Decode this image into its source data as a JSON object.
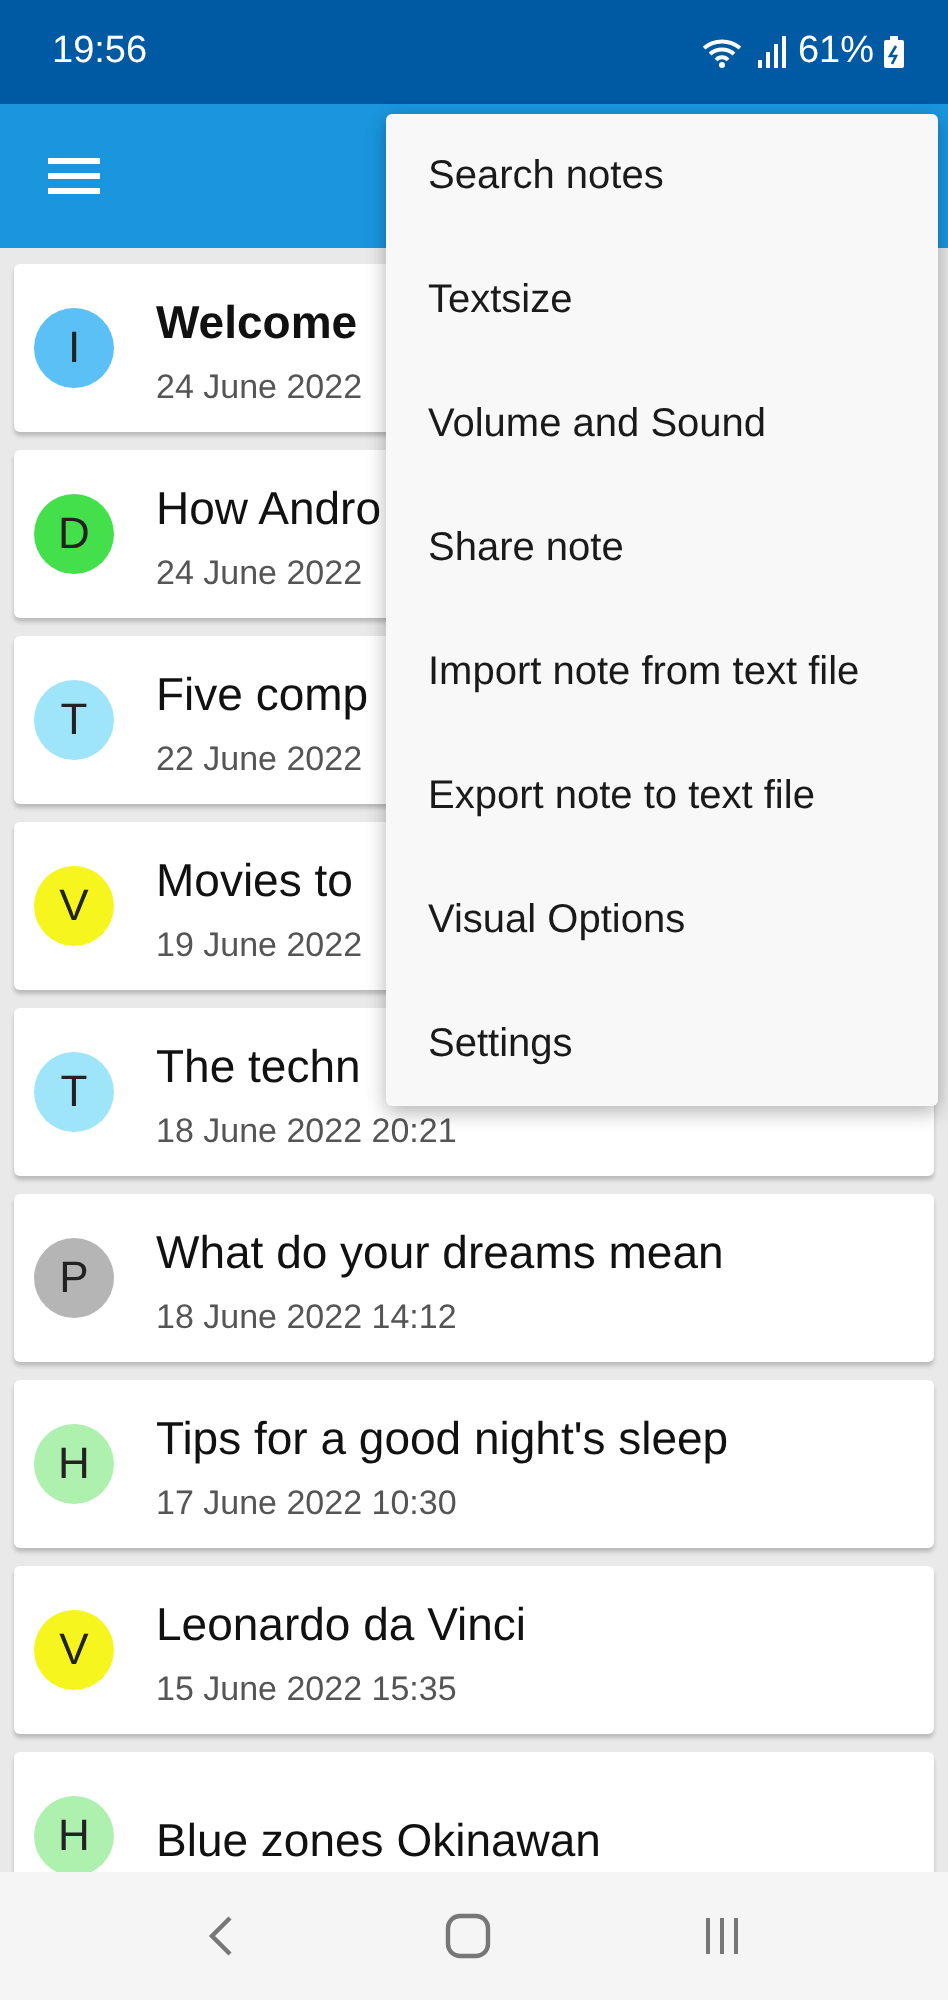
{
  "status_bar": {
    "time": "19:56",
    "battery": "61%"
  },
  "notes": [
    {
      "letter": "I",
      "color": "#5bc0f5",
      "title": "Welcome",
      "date": "24 June 2022"
    },
    {
      "letter": "D",
      "color": "#44e04c",
      "title": "How Andro",
      "date": "24 June 2022"
    },
    {
      "letter": "T",
      "color": "#9ee5fa",
      "title": "Five comp",
      "date": "22 June 2022"
    },
    {
      "letter": "V",
      "color": "#f7f51e",
      "title": "Movies to",
      "date": "19 June 2022"
    },
    {
      "letter": "T",
      "color": "#9ee5fa",
      "title": "The techn",
      "date": "18 June 2022 20:21"
    },
    {
      "letter": "P",
      "color": "#b5b5b5",
      "title": "What do your dreams mean",
      "date": "18 June 2022 14:12"
    },
    {
      "letter": "H",
      "color": "#aef0ae",
      "title": "Tips for a good night's sleep",
      "date": "17 June 2022 10:30"
    },
    {
      "letter": "V",
      "color": "#f7f51e",
      "title": "Leonardo da Vinci",
      "date": "15 June 2022 15:35"
    },
    {
      "letter": "H",
      "color": "#aef0ae",
      "title": "Blue zones Okinawan"
    }
  ],
  "menu": [
    "Search notes",
    "Textsize",
    "Volume and Sound",
    "Share note",
    "Import note from text file",
    "Export note to text file",
    "Visual Options",
    "Settings"
  ]
}
